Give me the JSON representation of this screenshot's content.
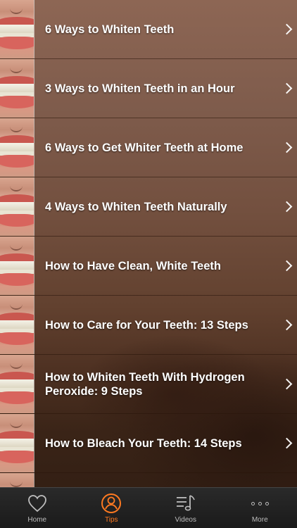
{
  "list": [
    {
      "label": "6 Ways to Whiten Teeth"
    },
    {
      "label": "3 Ways to Whiten Teeth in an Hour"
    },
    {
      "label": "6 Ways to Get Whiter Teeth at Home"
    },
    {
      "label": "4 Ways to Whiten Teeth Naturally"
    },
    {
      "label": "How to Have Clean, White Teeth"
    },
    {
      "label": "How to Care for Your Teeth: 13 Steps"
    },
    {
      "label": "How to Whiten Teeth With Hydrogen Peroxide: 9 Steps"
    },
    {
      "label": "How to Bleach Your Teeth: 14 Steps"
    },
    {
      "label": ""
    }
  ],
  "tabs": [
    {
      "label": "Home",
      "icon": "heart-icon"
    },
    {
      "label": "Tips",
      "icon": "person-circle-icon",
      "active": true
    },
    {
      "label": "Videos",
      "icon": "music-list-icon"
    },
    {
      "label": "More",
      "icon": "more-dots-icon"
    }
  ],
  "colors": {
    "accent": "#ff7a21",
    "tabbar": "#1f1f1f",
    "text": "#ffffff"
  }
}
